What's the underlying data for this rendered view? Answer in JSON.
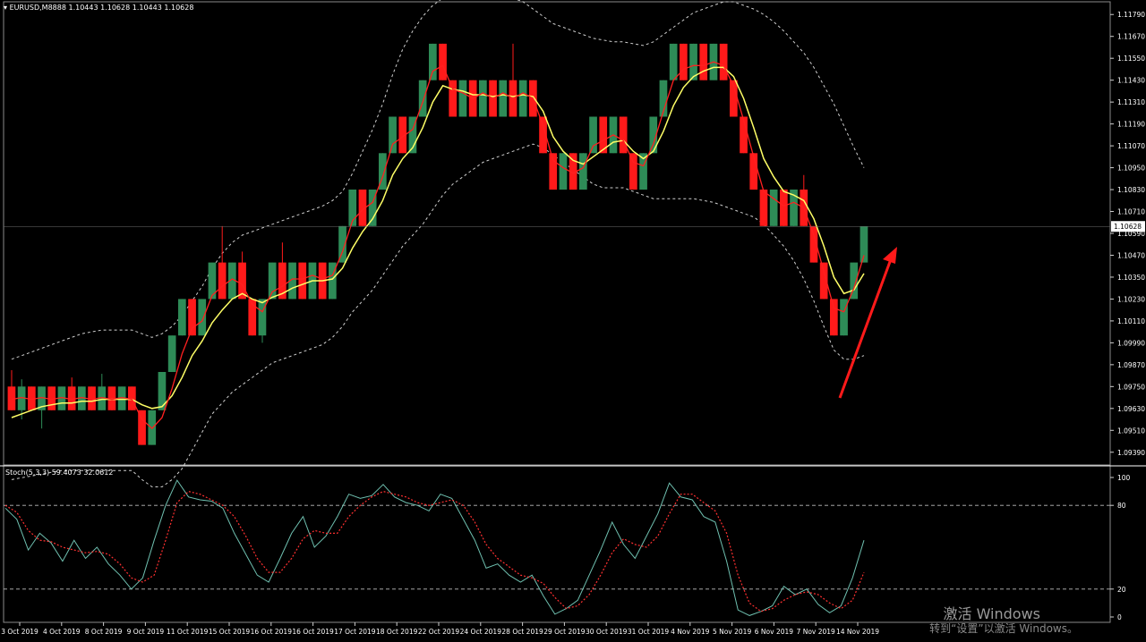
{
  "window": {
    "main_title": "EURUSD,M8888  1.10443 1.10628 1.10443 1.10628",
    "sub_title": "Stoch(5,3,3) 59.4073 32.0612",
    "current_price": "1.10628"
  },
  "watermark": {
    "line1": "激活 Windows",
    "line2": "转到“设置”以激活 Windows。"
  },
  "chart_data": [
    {
      "type": "candlestick",
      "symbol": "EURUSD",
      "timeframe": "M8888",
      "ylim": [
        1.0933,
        1.1185
      ],
      "yticks": [
        "1.11790",
        "1.11670",
        "1.11550",
        "1.11430",
        "1.11310",
        "1.11190",
        "1.11070",
        "1.10950",
        "1.10830",
        "1.10710",
        "1.10590",
        "1.10470",
        "1.10350",
        "1.10230",
        "1.10110",
        "1.09990",
        "1.09870",
        "1.09750",
        "1.09630",
        "1.09510",
        "1.09390"
      ],
      "xticks": [
        "3 Oct 2019",
        "4 Oct 2019",
        "8 Oct 2019",
        "9 Oct 2019",
        "11 Oct 2019",
        "15 Oct 2019",
        "16 Oct 2019",
        "16 Oct 2019",
        "17 Oct 2019",
        "18 Oct 2019",
        "22 Oct 2019",
        "24 Oct 2019",
        "28 Oct 2019",
        "29 Oct 2019",
        "30 Oct 2019",
        "31 Oct 2019",
        "4 Nov 2019",
        "5 Nov 2019",
        "6 Nov 2019",
        "7 Nov 2019",
        "14 Nov 2019"
      ],
      "colors": {
        "up": "#2e8b57",
        "down": "#ff1a1a",
        "ma_fast": "#ff2020",
        "ma_slow": "#ffff66",
        "bands": "#cfcfcf",
        "arrow": "#ff1a1a"
      },
      "candles": [
        [
          1.0975,
          1.0962,
          1.0984,
          1.0962
        ],
        [
          1.0962,
          1.0975,
          1.0979,
          1.0957
        ],
        [
          1.0975,
          1.0962,
          1.0975,
          1.0962
        ],
        [
          1.0962,
          1.0975,
          1.0975,
          1.0952
        ],
        [
          1.0975,
          1.0962,
          1.0975,
          1.0962
        ],
        [
          1.0962,
          1.0975,
          1.0975,
          1.0962
        ],
        [
          1.0975,
          1.0962,
          1.098,
          1.0962
        ],
        [
          1.0962,
          1.0975,
          1.0975,
          1.0962
        ],
        [
          1.0975,
          1.0962,
          1.0975,
          1.0962
        ],
        [
          1.0962,
          1.0975,
          1.0982,
          1.0962
        ],
        [
          1.0975,
          1.0962,
          1.0975,
          1.0962
        ],
        [
          1.0962,
          1.0975,
          1.0975,
          1.0962
        ],
        [
          1.0975,
          1.0962,
          1.0975,
          1.0962
        ],
        [
          1.0962,
          1.0943,
          1.0962,
          1.0943
        ],
        [
          1.0943,
          1.0962,
          1.0962,
          1.0943
        ],
        [
          1.0962,
          1.0983,
          1.0983,
          1.0962
        ],
        [
          1.0983,
          1.1003,
          1.1003,
          1.0983
        ],
        [
          1.1003,
          1.1023,
          1.1023,
          1.1003
        ],
        [
          1.1023,
          1.1003,
          1.1023,
          1.1003
        ],
        [
          1.1003,
          1.1023,
          1.1023,
          1.1003
        ],
        [
          1.1023,
          1.1043,
          1.1043,
          1.1023
        ],
        [
          1.1043,
          1.1023,
          1.1063,
          1.1023
        ],
        [
          1.1023,
          1.1043,
          1.1043,
          1.1023
        ],
        [
          1.1043,
          1.1023,
          1.1049,
          1.1023
        ],
        [
          1.1023,
          1.1003,
          1.1023,
          1.1003
        ],
        [
          1.1003,
          1.1023,
          1.1023,
          1.0999
        ],
        [
          1.1023,
          1.1043,
          1.1043,
          1.1023
        ],
        [
          1.1043,
          1.1023,
          1.1054,
          1.1023
        ],
        [
          1.1023,
          1.1043,
          1.1043,
          1.1023
        ],
        [
          1.1043,
          1.1023,
          1.1043,
          1.1023
        ],
        [
          1.1023,
          1.1043,
          1.1043,
          1.1023
        ],
        [
          1.1043,
          1.1023,
          1.1043,
          1.1023
        ],
        [
          1.1023,
          1.1043,
          1.1043,
          1.1023
        ],
        [
          1.1043,
          1.1063,
          1.1063,
          1.1043
        ],
        [
          1.1063,
          1.1083,
          1.1083,
          1.1063
        ],
        [
          1.1083,
          1.1063,
          1.1083,
          1.1063
        ],
        [
          1.1063,
          1.1083,
          1.1083,
          1.1063
        ],
        [
          1.1083,
          1.1103,
          1.1103,
          1.1083
        ],
        [
          1.1103,
          1.1123,
          1.1123,
          1.1103
        ],
        [
          1.1123,
          1.1103,
          1.1123,
          1.1103
        ],
        [
          1.1103,
          1.1123,
          1.1123,
          1.1103
        ],
        [
          1.1123,
          1.1143,
          1.1143,
          1.1123
        ],
        [
          1.1143,
          1.1163,
          1.1163,
          1.1143
        ],
        [
          1.1163,
          1.1143,
          1.1163,
          1.1143
        ],
        [
          1.1143,
          1.1123,
          1.1143,
          1.1123
        ],
        [
          1.1123,
          1.1143,
          1.1143,
          1.1123
        ],
        [
          1.1143,
          1.1123,
          1.1143,
          1.1123
        ],
        [
          1.1123,
          1.1143,
          1.1143,
          1.1123
        ],
        [
          1.1143,
          1.1123,
          1.1143,
          1.1123
        ],
        [
          1.1123,
          1.1143,
          1.1143,
          1.1123
        ],
        [
          1.1143,
          1.1123,
          1.1163,
          1.1123
        ],
        [
          1.1123,
          1.1143,
          1.1143,
          1.1123
        ],
        [
          1.1143,
          1.1123,
          1.1143,
          1.1123
        ],
        [
          1.1123,
          1.1103,
          1.1123,
          1.1103
        ],
        [
          1.1103,
          1.1083,
          1.1103,
          1.1083
        ],
        [
          1.1083,
          1.1103,
          1.1103,
          1.1083
        ],
        [
          1.1103,
          1.1083,
          1.1103,
          1.1083
        ],
        [
          1.1083,
          1.1103,
          1.1103,
          1.1083
        ],
        [
          1.1103,
          1.1123,
          1.1123,
          1.1103
        ],
        [
          1.1123,
          1.1103,
          1.1123,
          1.1103
        ],
        [
          1.1103,
          1.1123,
          1.1123,
          1.1103
        ],
        [
          1.1123,
          1.1103,
          1.1123,
          1.1103
        ],
        [
          1.1103,
          1.1083,
          1.1103,
          1.1083
        ],
        [
          1.1083,
          1.1103,
          1.1103,
          1.1083
        ],
        [
          1.1103,
          1.1123,
          1.1123,
          1.1103
        ],
        [
          1.1123,
          1.1143,
          1.1143,
          1.1123
        ],
        [
          1.1143,
          1.1163,
          1.1163,
          1.1143
        ],
        [
          1.1163,
          1.1143,
          1.1163,
          1.1143
        ],
        [
          1.1143,
          1.1163,
          1.1163,
          1.1143
        ],
        [
          1.1163,
          1.1143,
          1.1163,
          1.1143
        ],
        [
          1.1143,
          1.1163,
          1.1163,
          1.1143
        ],
        [
          1.1163,
          1.1143,
          1.1163,
          1.1143
        ],
        [
          1.1143,
          1.1123,
          1.1143,
          1.1123
        ],
        [
          1.1123,
          1.1103,
          1.1123,
          1.1103
        ],
        [
          1.1103,
          1.1083,
          1.1103,
          1.1083
        ],
        [
          1.1083,
          1.1063,
          1.1083,
          1.1063
        ],
        [
          1.1063,
          1.1083,
          1.1083,
          1.1063
        ],
        [
          1.1083,
          1.1063,
          1.1083,
          1.1063
        ],
        [
          1.1063,
          1.1083,
          1.1083,
          1.1063
        ],
        [
          1.1083,
          1.1063,
          1.1091,
          1.1063
        ],
        [
          1.1063,
          1.1043,
          1.1063,
          1.1043
        ],
        [
          1.1043,
          1.1023,
          1.1043,
          1.1023
        ],
        [
          1.1023,
          1.1003,
          1.1023,
          1.1003
        ],
        [
          1.1003,
          1.1023,
          1.1023,
          1.1003
        ],
        [
          1.1023,
          1.1043,
          1.1043,
          1.1023
        ],
        [
          1.1043,
          1.10628,
          1.10628,
          1.10443
        ]
      ],
      "ma_fast": [
        1.0968,
        1.0969,
        1.0968,
        1.0969,
        1.0968,
        1.0969,
        1.0968,
        1.0969,
        1.0968,
        1.0969,
        1.0968,
        1.0969,
        1.0968,
        1.0957,
        1.0952,
        1.0958,
        1.0974,
        1.0993,
        1.1007,
        1.1011,
        1.1025,
        1.103,
        1.1034,
        1.1031,
        1.102,
        1.1016,
        1.1027,
        1.103,
        1.1034,
        1.1034,
        1.1036,
        1.1034,
        1.1036,
        1.1049,
        1.1066,
        1.1072,
        1.1076,
        1.109,
        1.1108,
        1.1112,
        1.1116,
        1.1131,
        1.1148,
        1.1151,
        1.1138,
        1.1136,
        1.1133,
        1.1136,
        1.1133,
        1.1136,
        1.1133,
        1.1136,
        1.1133,
        1.1118,
        1.1099,
        1.1095,
        1.1092,
        1.1095,
        1.1107,
        1.111,
        1.1113,
        1.111,
        1.1098,
        1.1096,
        1.1108,
        1.1126,
        1.1143,
        1.1149,
        1.1151,
        1.1151,
        1.1153,
        1.1151,
        1.114,
        1.1121,
        1.1101,
        1.1082,
        1.1078,
        1.1074,
        1.1076,
        1.1073,
        1.1058,
        1.1038,
        1.1018,
        1.1016,
        1.1029,
        1.1047
      ],
      "ma_slow": [
        1.0958,
        1.096,
        1.0962,
        1.0964,
        1.0965,
        1.0966,
        1.0966,
        1.0967,
        1.0967,
        1.0968,
        1.0968,
        1.0968,
        1.0968,
        1.0965,
        1.0963,
        1.0964,
        1.097,
        1.098,
        1.0992,
        1.1,
        1.101,
        1.1017,
        1.1023,
        1.1026,
        1.1023,
        1.1021,
        1.1024,
        1.1026,
        1.1029,
        1.1031,
        1.1033,
        1.1033,
        1.1034,
        1.104,
        1.1051,
        1.106,
        1.1067,
        1.1077,
        1.1091,
        1.11,
        1.1106,
        1.1117,
        1.1131,
        1.114,
        1.1138,
        1.1137,
        1.1135,
        1.1135,
        1.1134,
        1.1135,
        1.1134,
        1.1135,
        1.1134,
        1.1126,
        1.1112,
        1.1104,
        1.1099,
        1.1097,
        1.1101,
        1.1105,
        1.1109,
        1.111,
        1.1104,
        1.11,
        1.1104,
        1.1115,
        1.1129,
        1.1139,
        1.1145,
        1.1148,
        1.115,
        1.115,
        1.1145,
        1.1133,
        1.1117,
        1.11,
        1.109,
        1.1082,
        1.108,
        1.1077,
        1.1067,
        1.1052,
        1.1035,
        1.1026,
        1.1028,
        1.1037
      ],
      "upper_band": [
        1.099,
        1.0992,
        1.0994,
        1.0996,
        1.0998,
        1.1,
        1.1002,
        1.1004,
        1.1005,
        1.1006,
        1.1006,
        1.1006,
        1.1006,
        1.1004,
        1.1002,
        1.1004,
        1.1008,
        1.1014,
        1.1022,
        1.103,
        1.104,
        1.1048,
        1.1054,
        1.1058,
        1.106,
        1.1062,
        1.1064,
        1.1066,
        1.1068,
        1.107,
        1.1072,
        1.1074,
        1.1077,
        1.1082,
        1.1092,
        1.1104,
        1.1116,
        1.113,
        1.1146,
        1.116,
        1.117,
        1.1178,
        1.1184,
        1.1188,
        1.119,
        1.119,
        1.119,
        1.119,
        1.119,
        1.119,
        1.1188,
        1.1186,
        1.1182,
        1.1178,
        1.1174,
        1.1172,
        1.117,
        1.1168,
        1.1166,
        1.1165,
        1.1164,
        1.1164,
        1.1163,
        1.1162,
        1.1164,
        1.1168,
        1.1172,
        1.1176,
        1.118,
        1.1182,
        1.1184,
        1.1186,
        1.1186,
        1.1184,
        1.1182,
        1.1179,
        1.1175,
        1.117,
        1.1164,
        1.1158,
        1.115,
        1.114,
        1.113,
        1.1118,
        1.1106,
        1.1095
      ],
      "lower_band": [
        1.0924,
        1.0925,
        1.0926,
        1.0927,
        1.0928,
        1.0929,
        1.0929,
        1.0929,
        1.0929,
        1.0929,
        1.0929,
        1.0929,
        1.0929,
        1.0924,
        1.092,
        1.092,
        1.0924,
        1.093,
        1.094,
        1.095,
        1.096,
        1.0966,
        1.0972,
        1.0976,
        1.098,
        1.0984,
        1.0988,
        1.099,
        1.0992,
        1.0994,
        1.0996,
        1.0998,
        1.1002,
        1.1008,
        1.1016,
        1.1022,
        1.1028,
        1.1036,
        1.1044,
        1.1052,
        1.1058,
        1.1064,
        1.1072,
        1.108,
        1.1086,
        1.109,
        1.1094,
        1.1098,
        1.11,
        1.1102,
        1.1104,
        1.1106,
        1.1108,
        1.1106,
        1.1102,
        1.1098,
        1.1094,
        1.109,
        1.1086,
        1.1084,
        1.1084,
        1.1084,
        1.1082,
        1.108,
        1.1078,
        1.1078,
        1.1078,
        1.1078,
        1.1078,
        1.1077,
        1.1076,
        1.1074,
        1.1072,
        1.107,
        1.1068,
        1.1064,
        1.1058,
        1.1052,
        1.1044,
        1.1034,
        1.1022,
        1.1008,
        1.0995,
        1.099,
        1.099,
        1.0992
      ]
    },
    {
      "type": "line",
      "name": "Stoch(5,3,3)",
      "ylim": [
        0,
        100
      ],
      "yticks": [
        "100",
        "80",
        "20",
        "0"
      ],
      "levels": [
        80,
        20
      ],
      "colors": {
        "main": "#6fc0b0",
        "signal": "#ff3030",
        "levels": "#bdbdbd"
      },
      "main_line": [
        78,
        70,
        48,
        60,
        53,
        40,
        55,
        42,
        50,
        38,
        30,
        20,
        28,
        55,
        80,
        98,
        86,
        84,
        83,
        78,
        60,
        45,
        30,
        25,
        42,
        60,
        72,
        50,
        58,
        72,
        88,
        85,
        87,
        95,
        86,
        82,
        80,
        76,
        88,
        85,
        70,
        55,
        35,
        38,
        30,
        25,
        30,
        15,
        2,
        6,
        12,
        30,
        48,
        68,
        52,
        42,
        58,
        74,
        96,
        86,
        84,
        72,
        68,
        40,
        5,
        1,
        4,
        8,
        22,
        16,
        20,
        9,
        3,
        8,
        28,
        55
      ],
      "signal_line": [
        80,
        75,
        62,
        55,
        54,
        50,
        48,
        46,
        47,
        45,
        38,
        28,
        25,
        30,
        55,
        82,
        90,
        88,
        84,
        80,
        72,
        58,
        42,
        32,
        32,
        42,
        56,
        62,
        60,
        60,
        72,
        80,
        86,
        90,
        88,
        86,
        82,
        80,
        82,
        84,
        80,
        68,
        52,
        42,
        36,
        30,
        28,
        24,
        14,
        6,
        8,
        16,
        30,
        46,
        56,
        52,
        50,
        58,
        74,
        88,
        88,
        82,
        76,
        60,
        30,
        10,
        4,
        6,
        12,
        16,
        18,
        16,
        10,
        6,
        12,
        32
      ]
    }
  ]
}
